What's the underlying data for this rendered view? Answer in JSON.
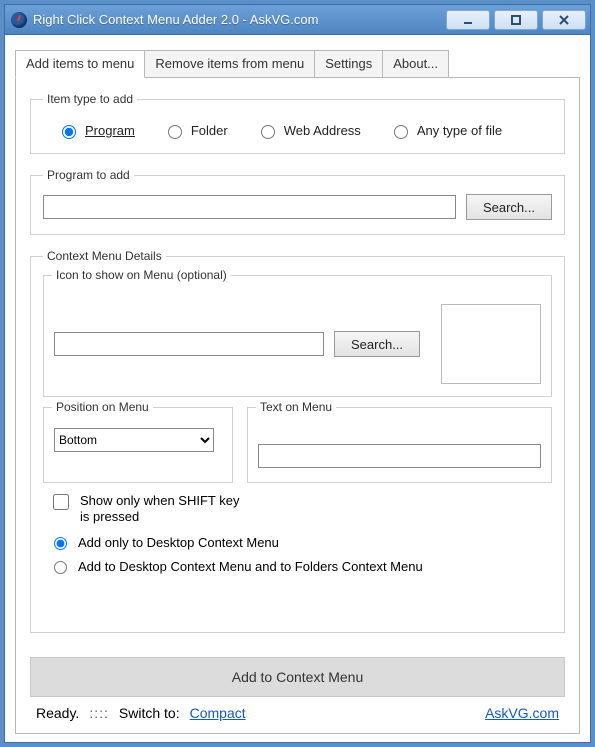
{
  "window": {
    "title": "Right Click Context Menu Adder 2.0  -  AskVG.com"
  },
  "tabs": {
    "add": "Add items to menu",
    "remove": "Remove items from menu",
    "settings": "Settings",
    "about": "About..."
  },
  "itemType": {
    "legend": "Item type to add",
    "program": "Program",
    "folder": "Folder",
    "web": "Web Address",
    "anyfile": "Any type of file"
  },
  "programToAdd": {
    "legend": "Program to add",
    "value": "",
    "search": "Search..."
  },
  "details": {
    "legend": "Context Menu Details",
    "icon": {
      "legend": "Icon to show on Menu (optional)",
      "value": "",
      "search": "Search..."
    },
    "position": {
      "legend": "Position on Menu",
      "selected": "Bottom"
    },
    "text": {
      "legend": "Text on Menu",
      "value": ""
    },
    "shiftOnly": "Show only when SHIFT key is pressed",
    "opt1": "Add only to Desktop Context Menu",
    "opt2": "Add to Desktop Context Menu and to Folders Context Menu"
  },
  "addButton": "Add to Context Menu",
  "status": {
    "ready": "Ready.",
    "switch": "Switch to:",
    "mode": "Compact",
    "link": "AskVG.com"
  }
}
